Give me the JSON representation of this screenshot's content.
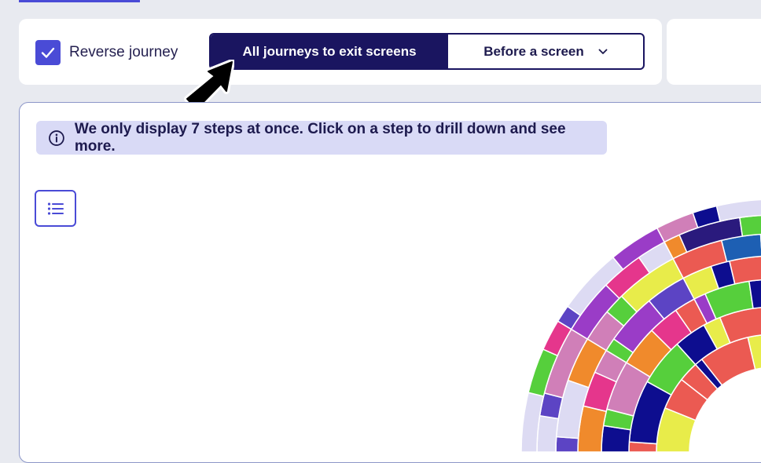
{
  "toolbar": {
    "reverse_journey_label": "Reverse journey",
    "reverse_journey_checked": true,
    "segment_active_label": "All journeys to exit screens",
    "segment_dropdown_label": "Before a screen"
  },
  "info": {
    "message": "We only display 7 steps at once. Click on a step to drill down and see more."
  },
  "icons": {
    "checkbox": "check-icon",
    "dropdown": "chevron-down-icon",
    "info": "info-icon",
    "list": "list-icon",
    "cursor": "mouse-pointer-icon"
  },
  "colors": {
    "accent": "#4a4bd6",
    "navy": "#1a1560",
    "info_bg": "#d9daf6",
    "sunburst_palette": [
      "#e8ec4a",
      "#eb5a52",
      "#0d0d8f",
      "#56cf3c",
      "#d07fb8",
      "#f08a2c",
      "#e5368c",
      "#9a3cc7",
      "#5c44c4",
      "#dddbf3",
      "#1d5fb3",
      "#2a1a7d"
    ]
  }
}
